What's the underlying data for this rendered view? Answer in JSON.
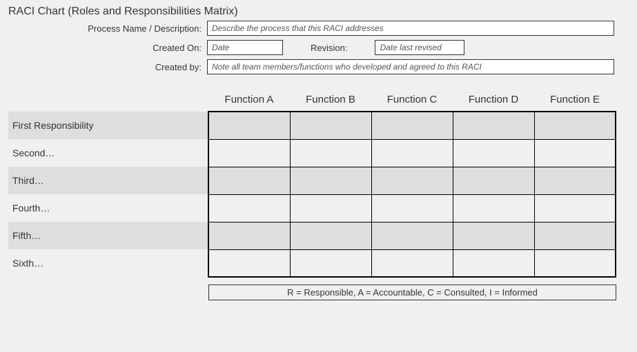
{
  "title": "RACI Chart (Roles and Responsibilities Matrix)",
  "meta": {
    "process_label": "Process Name / Description:",
    "process_placeholder": "Describe the process that this RACI addresses",
    "created_on_label": "Created On:",
    "created_on_placeholder": "Date",
    "revision_label": "Revision:",
    "revision_placeholder": "Date last revised",
    "created_by_label": "Created by:",
    "created_by_placeholder": "Note all team members/functions who developed and agreed to this RACI"
  },
  "chart_data": {
    "type": "table",
    "columns": [
      "Function A",
      "Function B",
      "Function C",
      "Function D",
      "Function E"
    ],
    "rows": [
      "First Responsibility",
      "Second…",
      "Third…",
      "Fourth…",
      "Fifth…",
      "Sixth…"
    ],
    "values": [
      [
        "",
        "",
        "",
        "",
        ""
      ],
      [
        "",
        "",
        "",
        "",
        ""
      ],
      [
        "",
        "",
        "",
        "",
        ""
      ],
      [
        "",
        "",
        "",
        "",
        ""
      ],
      [
        "",
        "",
        "",
        "",
        ""
      ],
      [
        "",
        "",
        "",
        "",
        ""
      ]
    ]
  },
  "legend": "R = Responsible, A = Accountable, C = Consulted, I = Informed"
}
